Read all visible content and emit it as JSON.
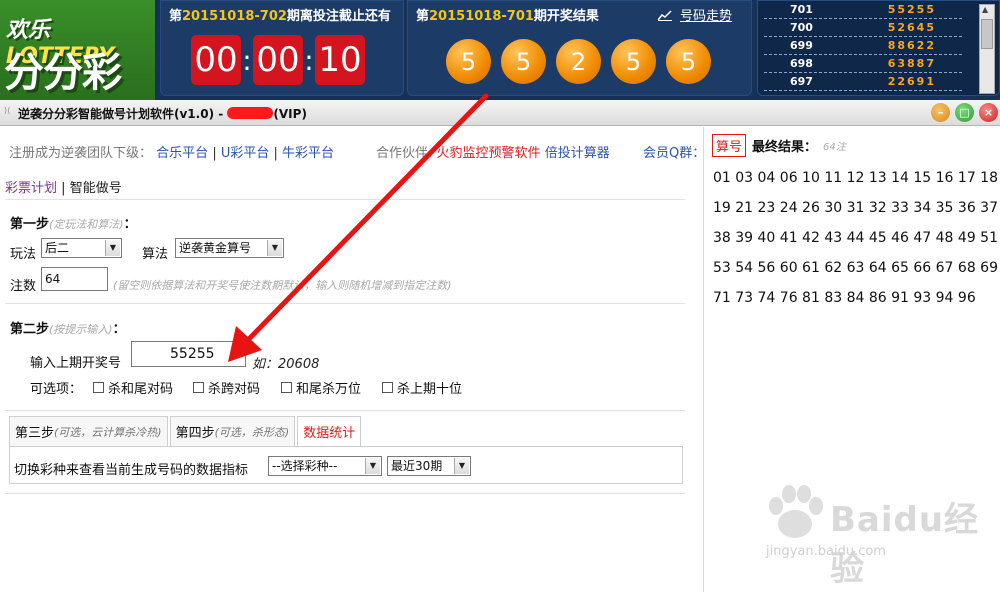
{
  "logo": {
    "line1_cn": "欢乐",
    "line1_en": "LOTTERY",
    "line2": "分分彩"
  },
  "countdown": {
    "prefix": "第",
    "issue": "20151018-702",
    "suffix": "期离投注截止还有",
    "digits": [
      "00",
      "00",
      "10"
    ]
  },
  "results": {
    "prefix": "第",
    "issue": "20151018-701",
    "suffix": "期开奖结果",
    "trend_label": "号码走势",
    "balls": [
      "5",
      "5",
      "2",
      "5",
      "5"
    ]
  },
  "history": [
    {
      "issue": "701",
      "nums": "55255"
    },
    {
      "issue": "700",
      "nums": "52645"
    },
    {
      "issue": "699",
      "nums": "88622"
    },
    {
      "issue": "698",
      "nums": "63887"
    },
    {
      "issue": "697",
      "nums": "22691"
    }
  ],
  "window": {
    "title_a": "逆袭分分彩智能做号计划软件(v1.0) -",
    "title_b": "(VIP)"
  },
  "topline": {
    "register": "注册成为逆袭团队下级：",
    "links": [
      "合乐平台",
      "U彩平台",
      "牛彩平台"
    ],
    "partner_label": "合作伙伴:",
    "partner_red": "火豹监控预警软件",
    "partner_link": "倍投计算器",
    "member": "会员Q群："
  },
  "subtabs": {
    "a": "彩票计划",
    "sep": "|",
    "b": "智能做号"
  },
  "step1": {
    "title": "第一步",
    "hint": "(定玩法和算法)",
    "colon": "：",
    "play_label": "玩法",
    "play_value": "后二",
    "algo_label": "算法",
    "algo_value": "逆袭黄金算号",
    "count_label": "注数",
    "count_value": "64",
    "count_hint": "(留空则依据算法和开奖号使注数期默认，输入则随机增减到指定注数)"
  },
  "step2": {
    "title": "第二步",
    "hint": "(按提示输入)",
    "colon": "：",
    "input_label": "输入上期开奖号",
    "input_value": "55255",
    "example": "如：20608",
    "options_label": "可选项：",
    "options": [
      "杀和尾对码",
      "杀跨对码",
      "和尾杀万位",
      "杀上期十位"
    ]
  },
  "tabs": [
    {
      "title": "第三步",
      "hint": "(可选，云计算杀冷热)"
    },
    {
      "title": "第四步",
      "hint": "(可选，杀形态)"
    },
    {
      "title": "数据统计",
      "hint": ""
    }
  ],
  "stats": {
    "text": "切换彩种来查看当前生成号码的数据指标",
    "lottery_select": "--选择彩种--",
    "period_select": "最近30期"
  },
  "final": {
    "button": "算号",
    "title": "最终结果：",
    "count": "64注",
    "numbers": "01 03 04 06 10 11 12 13 14 15 16 17 18 19 21 23 24 26 30 31 32 33 34 35 36 37 38 39 40 41 42 43 44 45 46 47 48 49 51 53 54 56 60 61 62 63 64 65 66 67 68 69 71 73 74 76 81 83 84 86 91 93 94 96"
  },
  "watermark": {
    "brand": "Baidu经验",
    "url": "jingyan.baidu.com"
  },
  "colors": {
    "banner": "#16325a",
    "accent_red": "#e01b1b",
    "ball_orange": "#f08a00",
    "link_blue": "#2a55a8"
  }
}
